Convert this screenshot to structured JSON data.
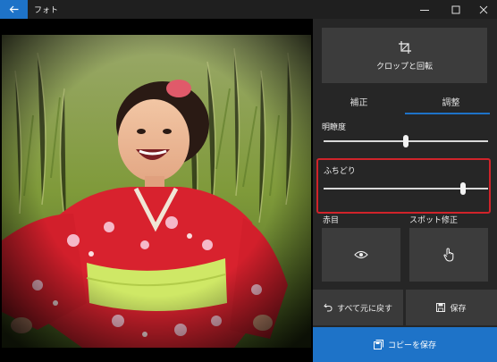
{
  "window": {
    "title": "フォト",
    "back_icon": "arrow-left-icon",
    "minimize_icon": "minimize-icon",
    "maximize_icon": "maximize-icon",
    "close_icon": "close-icon",
    "accent": "#1e73c8"
  },
  "photo": {
    "icon": "photo-image"
  },
  "panel": {
    "crop_label": "クロップと回転",
    "tabs": [
      {
        "label": "補正",
        "selected": false
      },
      {
        "label": "調整",
        "selected": true
      }
    ],
    "clarity": {
      "label": "明瞭度",
      "value_fraction": 0.5
    },
    "vignette": {
      "label": "ふちどり",
      "value_fraction": 0.85
    },
    "redeye_label": "赤目",
    "spotfix_label": "スポット修正",
    "revert_label": "すべて元に戻す",
    "save_label": "保存",
    "copy_save_label": "コピーを保存",
    "highlight_color": "#d0232a"
  }
}
